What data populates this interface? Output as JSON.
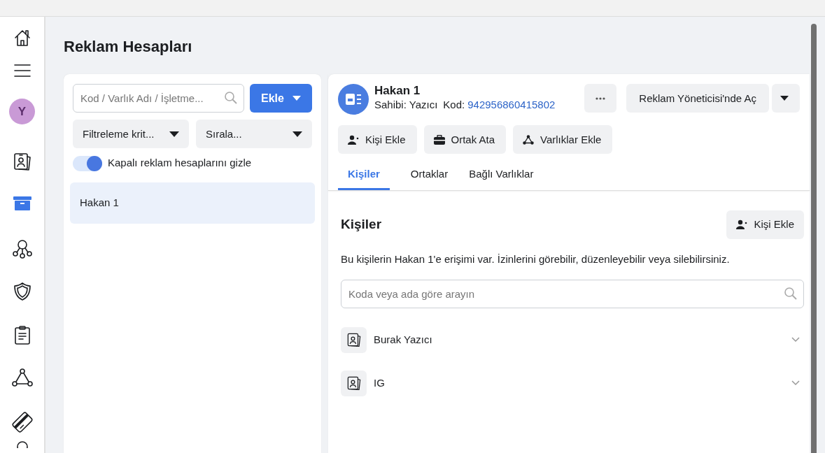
{
  "title": "Reklam Hesapları",
  "sidebar": {
    "items": [
      {
        "kind": "home",
        "selected": false
      },
      {
        "kind": "menu",
        "selected": false
      },
      {
        "kind": "avatar",
        "letter": "Y",
        "selected": false
      },
      {
        "kind": "id-card",
        "selected": false
      },
      {
        "kind": "archive",
        "selected": true
      },
      {
        "kind": "network",
        "selected": false
      },
      {
        "kind": "shield",
        "selected": false
      },
      {
        "kind": "clipboard",
        "selected": false
      },
      {
        "kind": "triangle",
        "selected": false
      },
      {
        "kind": "card",
        "selected": false
      },
      {
        "kind": "person",
        "selected": false
      }
    ]
  },
  "accounts_panel": {
    "search": {
      "placeholder": "Kod / Varlık Adı / İşletme..."
    },
    "add_button": "Ekle",
    "filters": [
      "Filtreleme krit...",
      "Sırala..."
    ],
    "toggle": {
      "label": "Kapalı reklam hesaplarını gizle",
      "on": true
    },
    "accounts": [
      {
        "name": "Hakan 1",
        "selected": true
      }
    ]
  },
  "detail": {
    "name": "Hakan 1",
    "owner": "Sahibi: Yazıcı",
    "code_label": "Kod:",
    "code": "942956860415802",
    "open_button": "Reklam Yöneticisi'nde Aç",
    "actions": [
      {
        "kind": "person",
        "label": "Kişi Ekle"
      },
      {
        "kind": "briefcase",
        "label": "Ortak Ata"
      },
      {
        "kind": "triangle",
        "label": "Varlıklar Ekle"
      }
    ],
    "tabs": [
      {
        "label": "Kişiler",
        "selected": true
      },
      {
        "label": "Ortaklar",
        "selected": false
      },
      {
        "label": "Bağlı Varlıklar",
        "selected": false
      }
    ],
    "section": {
      "title": "Kişiler",
      "add_button": "Kişi Ekle",
      "description": "Bu kişilerin Hakan 1'e erişimi var. İzinlerini görebilir, düzenleyebilir veya silebilirsiniz.",
      "search": {
        "placeholder": "Koda veya ada göre arayın"
      },
      "people": [
        {
          "name": "Burak Yazıcı"
        },
        {
          "name": "IG"
        }
      ]
    }
  }
}
